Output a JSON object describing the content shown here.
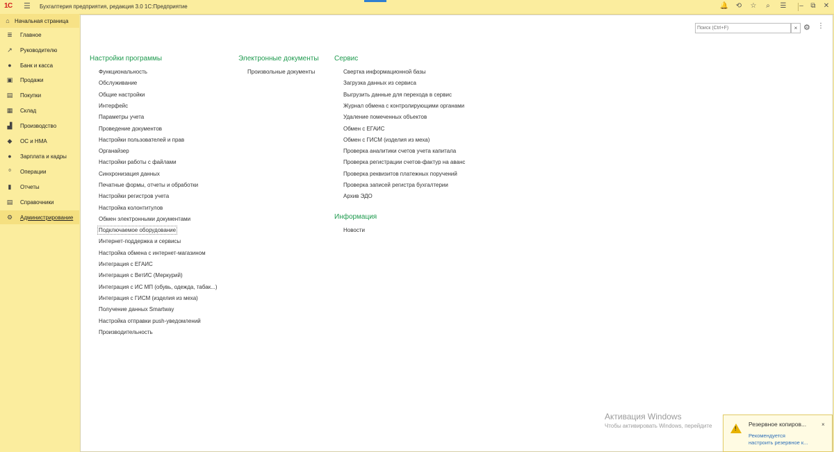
{
  "titlebar": {
    "logo": "1С",
    "menu_icon": "☰",
    "title": "Бухгалтерия предприятия, редакция 3.0 1С:Предприятие",
    "icons": {
      "bell": "🔔",
      "history": "⟲",
      "star": "☆",
      "search": "⌕",
      "settings": "☰",
      "minimize": "–",
      "restore": "⧉",
      "close": "✕"
    }
  },
  "sidebar": {
    "home_label": "Начальная страница",
    "items": [
      {
        "label": "Главное",
        "icon": "≣"
      },
      {
        "label": "Руководителю",
        "icon": "↗"
      },
      {
        "label": "Банк и касса",
        "icon": "●"
      },
      {
        "label": "Продажи",
        "icon": "▣"
      },
      {
        "label": "Покупки",
        "icon": "▤"
      },
      {
        "label": "Склад",
        "icon": "▦"
      },
      {
        "label": "Производство",
        "icon": "▟"
      },
      {
        "label": "ОС и НМА",
        "icon": "◆"
      },
      {
        "label": "Зарплата и кадры",
        "icon": "●"
      },
      {
        "label": "Операции",
        "icon": "⁰"
      },
      {
        "label": "Отчеты",
        "icon": "▮"
      },
      {
        "label": "Справочники",
        "icon": "▤"
      },
      {
        "label": "Администрирование",
        "icon": "⚙"
      }
    ]
  },
  "search": {
    "placeholder": "Поиск (Ctrl+F)",
    "clear": "×"
  },
  "toolbar": {
    "settings_icon": "⚙",
    "more_icon": "⋮"
  },
  "sections": {
    "settings": {
      "title": "Настройки программы",
      "items": [
        "Функциональность",
        "Обслуживание",
        "Общие настройки",
        "Интерфейс",
        "Параметры учета",
        "Проведение документов",
        "Настройки пользователей и прав",
        "Органайзер",
        "Настройки работы с файлами",
        "Синхронизация данных",
        "Печатные формы, отчеты и обработки",
        "Настройки регистров учета",
        "Настройка колонтитулов",
        "Обмен электронными документами",
        "Подключаемое оборудование",
        "Интернет-поддержка и сервисы",
        "Настройка обмена с интернет-магазином",
        "Интеграция с ЕГАИС",
        "Интеграция с ВетИС (Меркурий)",
        "Интеграция с ИС МП (обувь, одежда, табак...)",
        "Интеграция с ГИСМ (изделия из меха)",
        "Получение данных Smartway",
        "Настройка отправки push-уведомлений",
        "Производительность"
      ]
    },
    "edocs": {
      "title": "Электронные документы",
      "items": [
        "Произвольные документы"
      ]
    },
    "service": {
      "title": "Сервис",
      "items": [
        "Свертка информационной базы",
        "Загрузка данных из сервиса",
        "Выгрузить данные для перехода в сервис",
        "Журнал обмена с контролирующими органами",
        "Удаление помеченных объектов",
        "Обмен с ЕГАИС",
        "Обмен с ГИСМ (изделия из меха)",
        "Проверка аналитики счетов учета капитала",
        "Проверка регистрации счетов-фактур на аванс",
        "Проверка реквизитов платежных поручений",
        "Проверка записей регистра бухгалтерии",
        "Архив ЭДО"
      ]
    },
    "info": {
      "title": "Информация",
      "items": [
        "Новости"
      ]
    }
  },
  "watermark": {
    "title": "Активация Windows",
    "text": "Чтобы активировать Windows, перейдите"
  },
  "notification": {
    "title": "Резервное копиров...",
    "text_line1": "Рекомендуется",
    "text_line2": "настроить резервное к...",
    "close": "×",
    "bang": "!"
  }
}
